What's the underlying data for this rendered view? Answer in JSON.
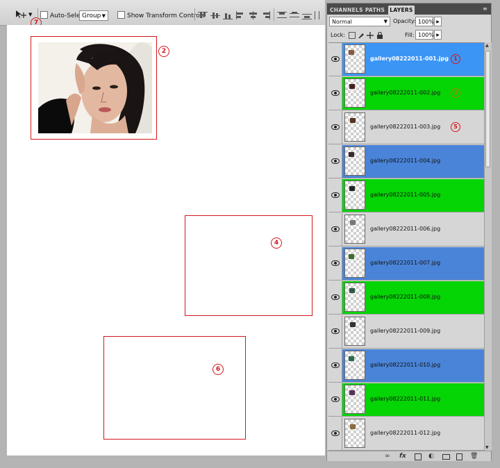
{
  "options_bar": {
    "auto_select_label": "Auto-Select:",
    "auto_select_value": "Group",
    "show_transform_label": "Show Transform Controls",
    "tool_badge": "7"
  },
  "canvas": {
    "frames": [
      {
        "badge": "2"
      },
      {
        "badge": "4"
      },
      {
        "badge": "6"
      }
    ]
  },
  "panel": {
    "tabs": [
      "CHANNELS",
      "PATHS",
      "LAYERS"
    ],
    "blend_mode": "Normal",
    "opacity_label": "Opacity:",
    "opacity_value": "100%",
    "lock_label": "Lock:",
    "fill_label": "Fill:",
    "fill_value": "100%"
  },
  "layers": [
    {
      "name": "gallery08222011-001.jpg",
      "bg": "#3b95f5",
      "text_color": "#ffffff",
      "bold": true,
      "badge": "1"
    },
    {
      "name": "gallery08222011-002.jpg",
      "bg": "#05d405",
      "text_color": "#111111",
      "bold": false,
      "badge": "3"
    },
    {
      "name": "gallery08222011-003.jpg",
      "bg": "#d6d6d6",
      "text_color": "#111111",
      "bold": false,
      "badge": "5"
    },
    {
      "name": "gallery08222011-004.jpg",
      "bg": "#4a84d8",
      "text_color": "#111111",
      "bold": false,
      "badge": ""
    },
    {
      "name": "gallery08222011-005.jpg",
      "bg": "#05d405",
      "text_color": "#111111",
      "bold": false,
      "badge": ""
    },
    {
      "name": "gallery08222011-006.jpg",
      "bg": "#d6d6d6",
      "text_color": "#111111",
      "bold": false,
      "badge": ""
    },
    {
      "name": "gallery08222011-007.jpg",
      "bg": "#4a84d8",
      "text_color": "#111111",
      "bold": false,
      "badge": ""
    },
    {
      "name": "gallery08222011-008.jpg",
      "bg": "#05d405",
      "text_color": "#111111",
      "bold": false,
      "badge": ""
    },
    {
      "name": "gallery08222011-009.jpg",
      "bg": "#d6d6d6",
      "text_color": "#111111",
      "bold": false,
      "badge": ""
    },
    {
      "name": "gallery08222011-010.jpg",
      "bg": "#4a84d8",
      "text_color": "#111111",
      "bold": false,
      "badge": ""
    },
    {
      "name": "gallery08222011-011.jpg",
      "bg": "#05d405",
      "text_color": "#111111",
      "bold": false,
      "badge": ""
    },
    {
      "name": "gallery08222011-012.jpg",
      "bg": "#d6d6d6",
      "text_color": "#111111",
      "bold": false,
      "badge": ""
    }
  ],
  "footer_icons": [
    "link-icon",
    "fx-icon",
    "mask-icon",
    "adjustment-icon",
    "group-icon",
    "new-layer-icon",
    "trash-icon"
  ]
}
